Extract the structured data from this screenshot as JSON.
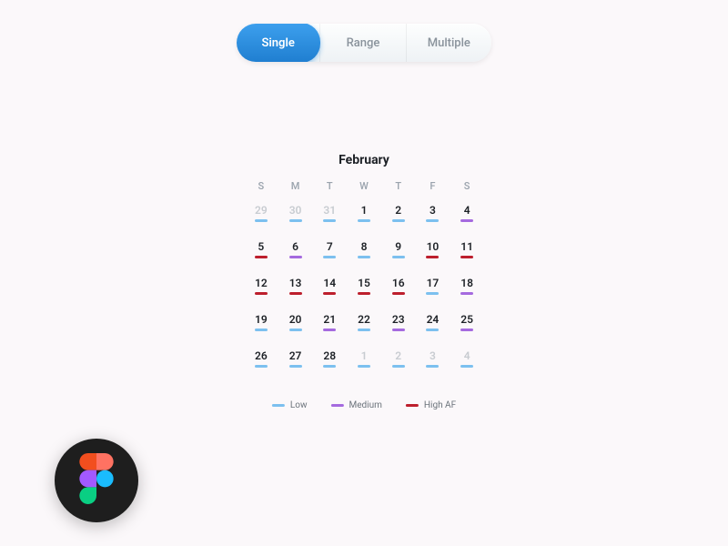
{
  "tabs": {
    "items": [
      {
        "label": "Single",
        "active": true
      },
      {
        "label": "Range",
        "active": false
      },
      {
        "label": "Multiple",
        "active": false
      }
    ]
  },
  "calendar": {
    "month": "February",
    "dow": [
      "S",
      "M",
      "T",
      "W",
      "T",
      "F",
      "S"
    ],
    "days": [
      {
        "n": "29",
        "out": true,
        "lvl": "low"
      },
      {
        "n": "30",
        "out": true,
        "lvl": "low"
      },
      {
        "n": "31",
        "out": true,
        "lvl": "low"
      },
      {
        "n": "1",
        "out": false,
        "lvl": "low"
      },
      {
        "n": "2",
        "out": false,
        "lvl": "low"
      },
      {
        "n": "3",
        "out": false,
        "lvl": "low"
      },
      {
        "n": "4",
        "out": false,
        "lvl": "med"
      },
      {
        "n": "5",
        "out": false,
        "lvl": "high"
      },
      {
        "n": "6",
        "out": false,
        "lvl": "med"
      },
      {
        "n": "7",
        "out": false,
        "lvl": "low"
      },
      {
        "n": "8",
        "out": false,
        "lvl": "low"
      },
      {
        "n": "9",
        "out": false,
        "lvl": "low"
      },
      {
        "n": "10",
        "out": false,
        "lvl": "high"
      },
      {
        "n": "11",
        "out": false,
        "lvl": "high"
      },
      {
        "n": "12",
        "out": false,
        "lvl": "high"
      },
      {
        "n": "13",
        "out": false,
        "lvl": "high"
      },
      {
        "n": "14",
        "out": false,
        "lvl": "high"
      },
      {
        "n": "15",
        "out": false,
        "lvl": "high"
      },
      {
        "n": "16",
        "out": false,
        "lvl": "high"
      },
      {
        "n": "17",
        "out": false,
        "lvl": "low"
      },
      {
        "n": "18",
        "out": false,
        "lvl": "med"
      },
      {
        "n": "19",
        "out": false,
        "lvl": "low"
      },
      {
        "n": "20",
        "out": false,
        "lvl": "low"
      },
      {
        "n": "21",
        "out": false,
        "lvl": "med"
      },
      {
        "n": "22",
        "out": false,
        "lvl": "low"
      },
      {
        "n": "23",
        "out": false,
        "lvl": "med"
      },
      {
        "n": "24",
        "out": false,
        "lvl": "low"
      },
      {
        "n": "25",
        "out": false,
        "lvl": "med"
      },
      {
        "n": "26",
        "out": false,
        "lvl": "low"
      },
      {
        "n": "27",
        "out": false,
        "lvl": "low"
      },
      {
        "n": "28",
        "out": false,
        "lvl": "low"
      },
      {
        "n": "1",
        "out": true,
        "lvl": "low"
      },
      {
        "n": "2",
        "out": true,
        "lvl": "low"
      },
      {
        "n": "3",
        "out": true,
        "lvl": "low"
      },
      {
        "n": "4",
        "out": true,
        "lvl": "low"
      }
    ]
  },
  "legend": {
    "items": [
      {
        "label": "Low",
        "lvl": "low"
      },
      {
        "label": "Medium",
        "lvl": "med"
      },
      {
        "label": "High AF",
        "lvl": "high"
      }
    ]
  },
  "badge": {
    "name": "figma"
  }
}
